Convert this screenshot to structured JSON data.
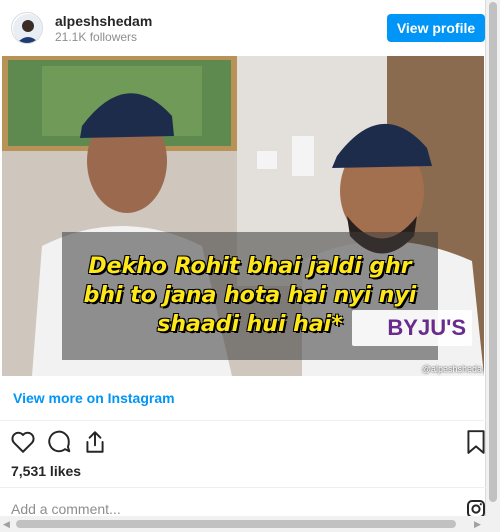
{
  "profile": {
    "username": "alpeshshedam",
    "followers": "21.1K followers",
    "view_profile_label": "View profile"
  },
  "post": {
    "caption_lines": [
      "Dekho Rohit bhai jaldi ghr",
      "bhi to jana hota hai nyi nyi",
      "shaadi hui hai*"
    ],
    "watermark": "@alpeshsheda",
    "sponsor_text": "BYJU'S",
    "view_more_label": "View more on Instagram",
    "likes": "7,531 likes"
  },
  "comment": {
    "placeholder": "Add a comment..."
  },
  "colors": {
    "accent": "#0095f6",
    "caption_text": "#ffe819"
  },
  "icons": [
    "heart-icon",
    "comment-icon",
    "share-icon",
    "bookmark-icon",
    "instagram-icon"
  ]
}
